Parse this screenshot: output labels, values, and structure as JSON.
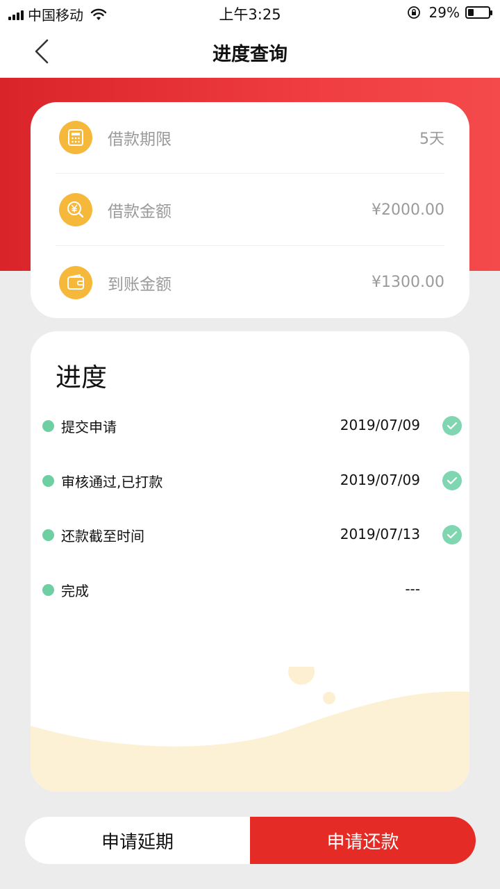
{
  "status_bar": {
    "carrier": "中国移动",
    "time": "上午3:25",
    "battery_percent": "29%",
    "battery_level": 0.29,
    "icons": [
      "signal-icon",
      "wifi-icon",
      "orientation-lock-icon",
      "battery-icon"
    ]
  },
  "nav": {
    "title": "进度查询",
    "back_icon": "chevron-left-icon"
  },
  "info": {
    "items": [
      {
        "label": "借款期限",
        "value": "5天",
        "icon": "calculator-icon"
      },
      {
        "label": "借款金额",
        "value": "¥2000.00",
        "icon": "yen-search-icon"
      },
      {
        "label": "到账金额",
        "value": "¥1300.00",
        "icon": "wallet-icon"
      }
    ]
  },
  "progress": {
    "title": "进度",
    "steps": [
      {
        "label": "提交申请",
        "date": "2019/07/09",
        "done": true
      },
      {
        "label": "审核通过,已打款",
        "date": "2019/07/09",
        "done": true
      },
      {
        "label": "还款截至时间",
        "date": "2019/07/13",
        "done": true
      },
      {
        "label": "完成",
        "date": "---",
        "done": false
      }
    ]
  },
  "actions": {
    "extend_label": "申请延期",
    "repay_label": "申请还款"
  },
  "colors": {
    "brand_red": "#e52b25",
    "banner_red": "#ef3c40",
    "coin_yellow": "#f6b83a",
    "status_green": "#6ecfa3",
    "wave_cream": "#fdf1d5"
  }
}
